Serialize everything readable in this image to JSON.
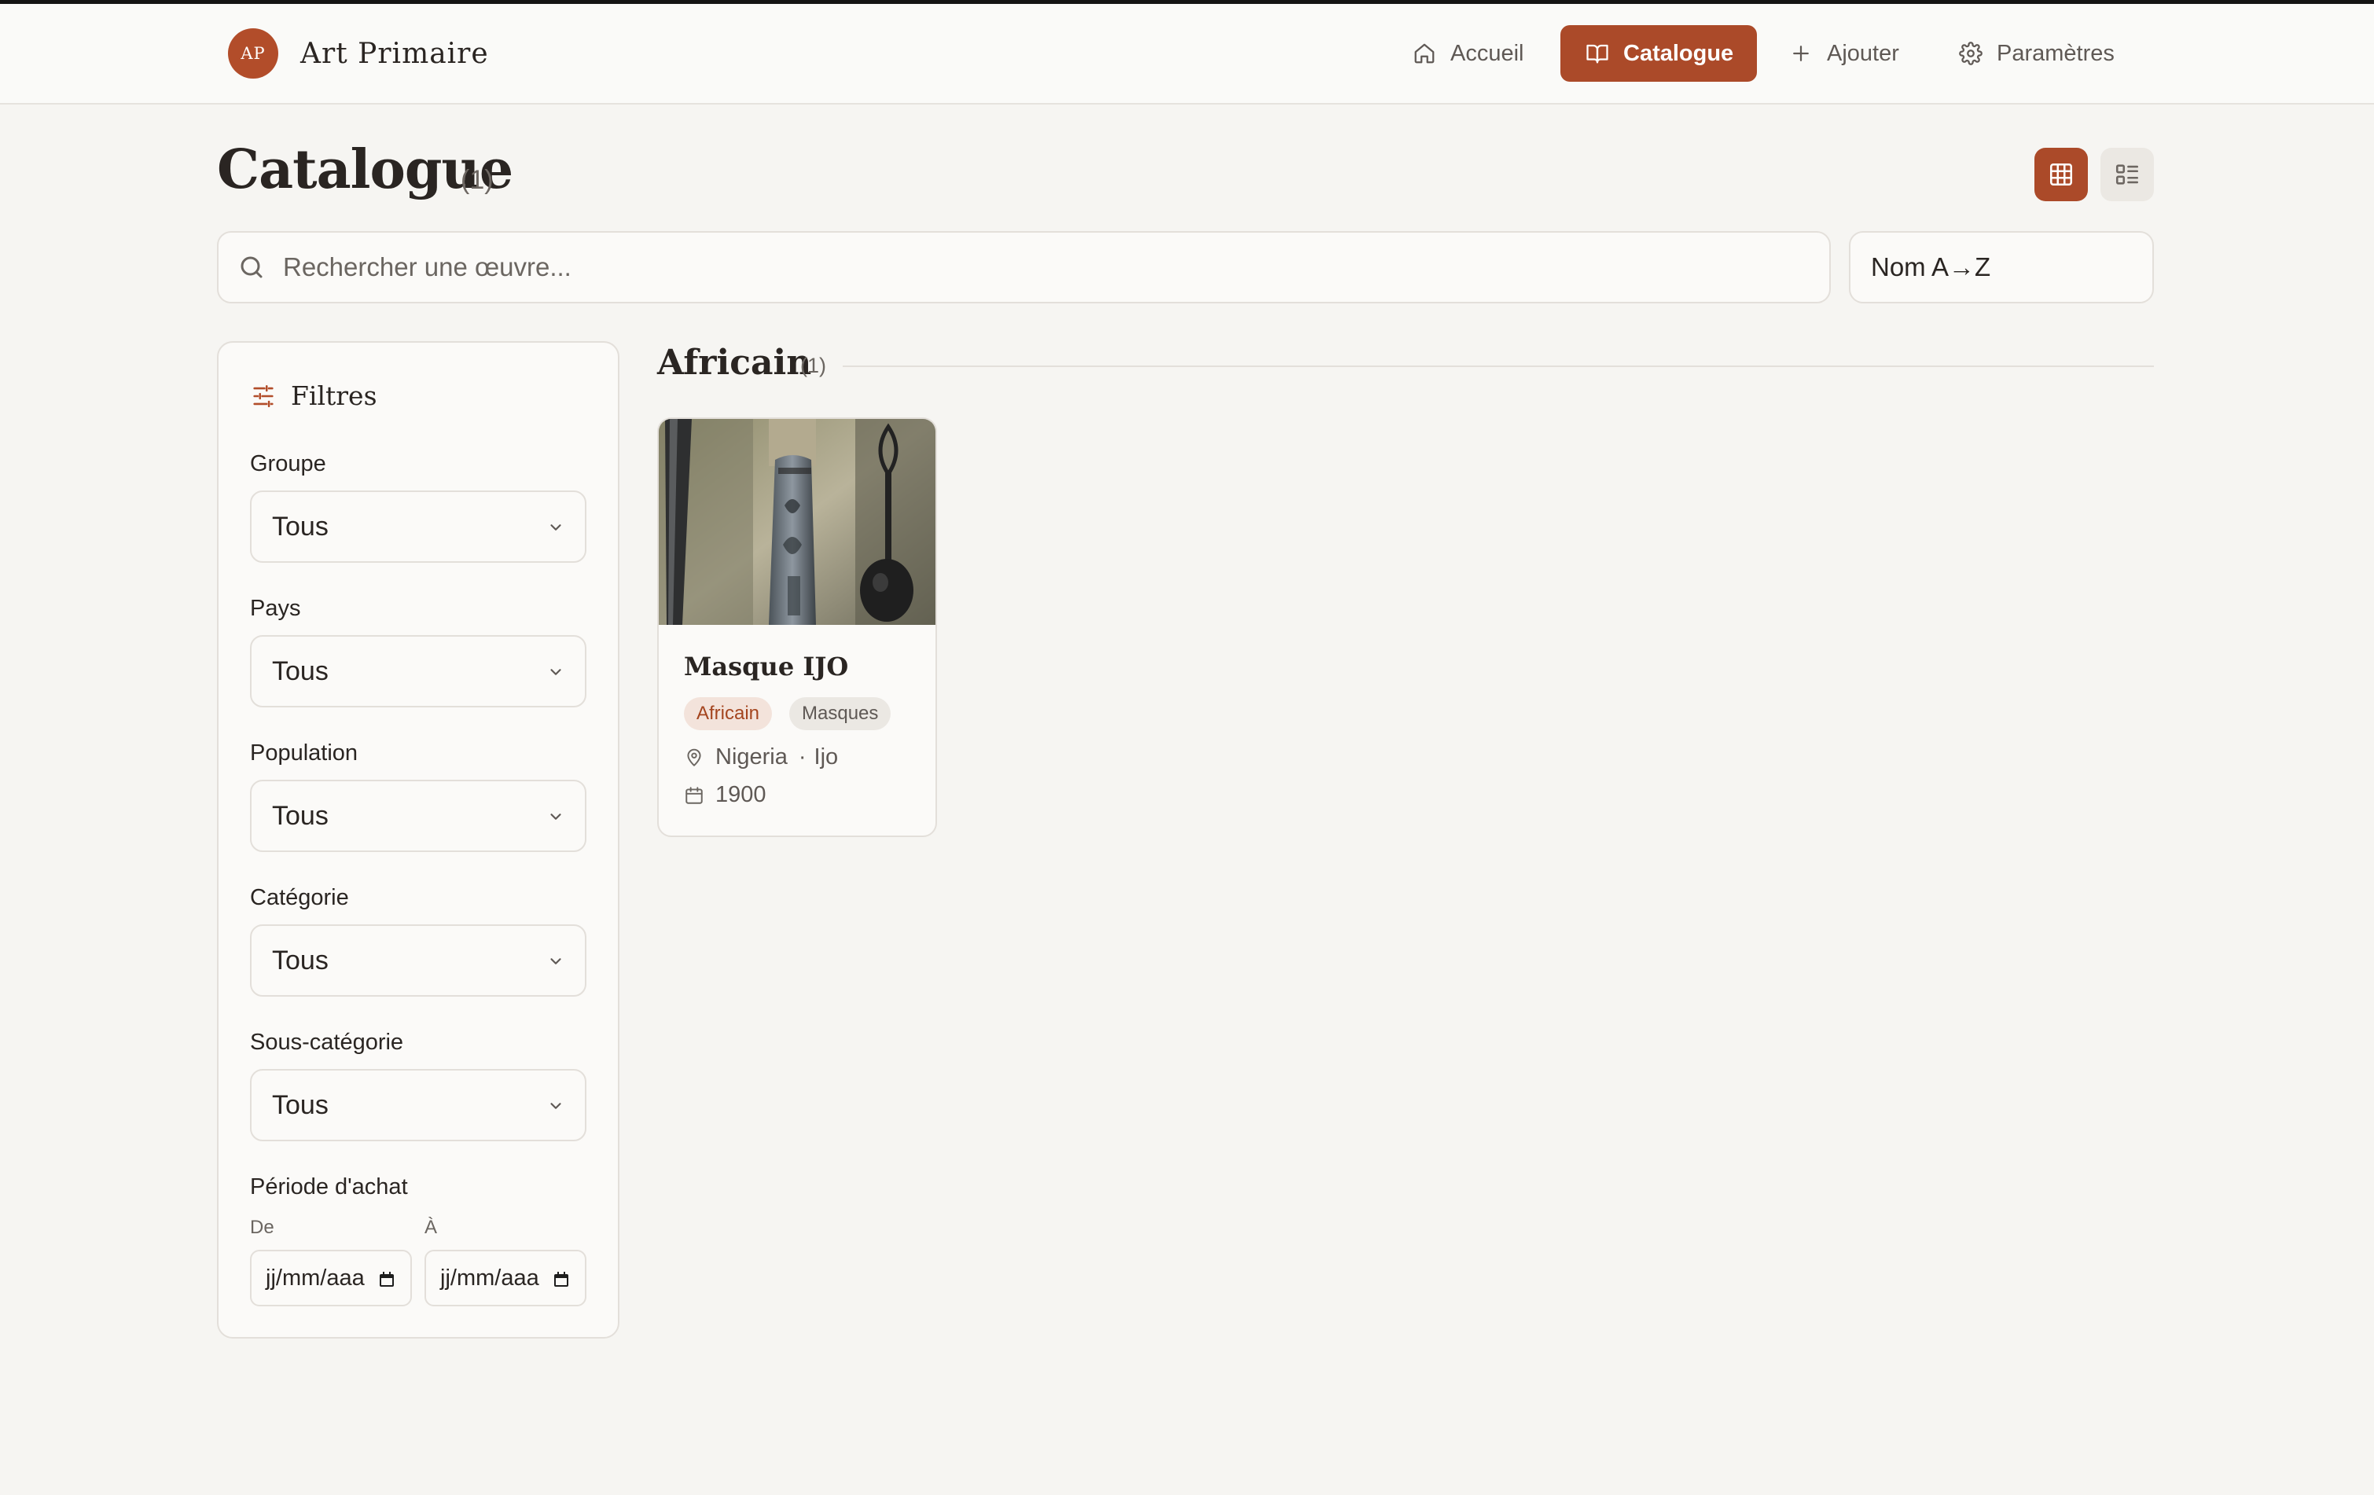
{
  "app": {
    "logo_initials": "AP",
    "name": "Art Primaire"
  },
  "nav": {
    "accueil": "Accueil",
    "catalogue": "Catalogue",
    "ajouter": "Ajouter",
    "parametres": "Paramètres"
  },
  "page": {
    "title": "Catalogue",
    "count": "(1)"
  },
  "search": {
    "placeholder": "Rechercher une œuvre..."
  },
  "sort": {
    "selected": "Nom A→Z"
  },
  "filters": {
    "title": "Filtres",
    "groupe": {
      "label": "Groupe",
      "value": "Tous"
    },
    "pays": {
      "label": "Pays",
      "value": "Tous"
    },
    "population": {
      "label": "Population",
      "value": "Tous"
    },
    "categorie": {
      "label": "Catégorie",
      "value": "Tous"
    },
    "sous_categorie": {
      "label": "Sous-catégorie",
      "value": "Tous"
    },
    "periode": {
      "label": "Période d'achat",
      "from_label": "De",
      "to_label": "À",
      "from_value": "jj/mm/aaa",
      "to_value": "jj/mm/aaa"
    }
  },
  "section": {
    "title": "Africain",
    "count": "(1)"
  },
  "items": [
    {
      "title": "Masque IJO",
      "tag_group": "Africain",
      "tag_category": "Masques",
      "country": "Nigeria",
      "separator": "·",
      "population": "Ijo",
      "year": "1900"
    }
  ],
  "colors": {
    "accent": "#ab4a29",
    "background": "#f6f5f2",
    "border": "#e3dfda"
  }
}
